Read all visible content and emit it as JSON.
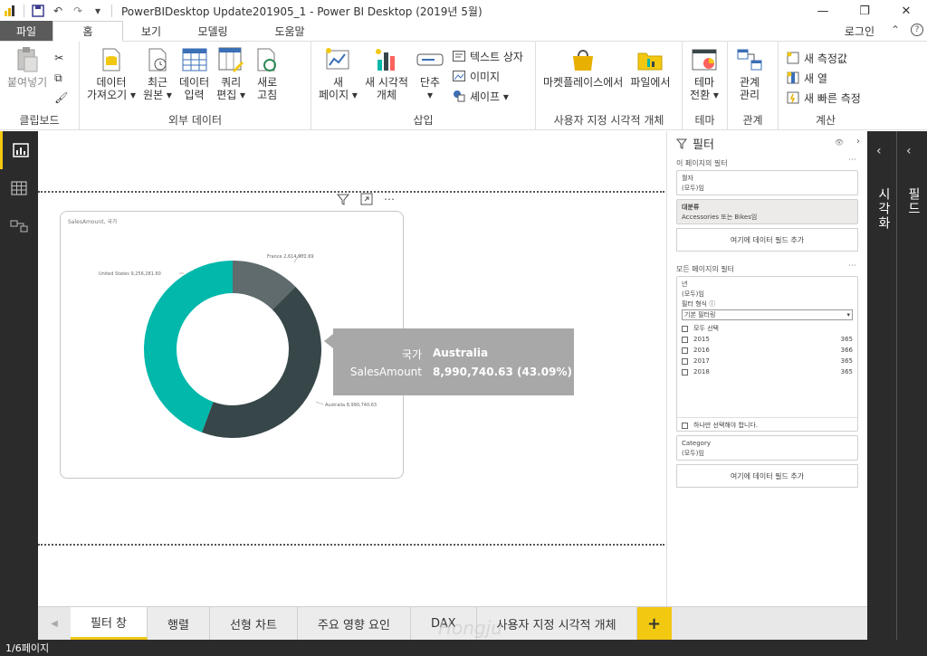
{
  "titlebar": {
    "title": "PowerBIDesktop Update201905_1 - Power BI Desktop (2019년 5월)"
  },
  "ribbon_tabs": {
    "file": "파일",
    "home": "홈",
    "view": "보기",
    "modeling": "모델링",
    "help": "도움말",
    "login": "로그인"
  },
  "ribbon": {
    "clipboard": {
      "paste": "붙여넣기",
      "label": "클립보드"
    },
    "external": {
      "get_data_1": "데이터",
      "get_data_2": "가져오기 ▾",
      "recent_1": "최근",
      "recent_2": "원본 ▾",
      "enter_1": "데이터",
      "enter_2": "입력",
      "query_1": "쿼리",
      "query_2": "편집 ▾",
      "refresh_1": "새로",
      "refresh_2": "고침",
      "label": "외부 데이터"
    },
    "insert": {
      "newpage_1": "새",
      "newpage_2": "페이지 ▾",
      "newvisual_1": "새 시각적",
      "newvisual_2": "개체",
      "ask_1": "단추",
      "ask_2": "▾",
      "textbox": "텍스트 상자",
      "image": "이미지",
      "shapes": "셰이프 ▾",
      "label": "삽입"
    },
    "custom": {
      "marketplace": "마켓플레이스에서",
      "fromfile": "파일에서",
      "label": "사용자 지정 시각적 개체"
    },
    "theme": {
      "switch_1": "테마",
      "switch_2": "전환 ▾",
      "label": "테마"
    },
    "relations": {
      "manage_1": "관계",
      "manage_2": "관리",
      "label": "관계"
    },
    "calc": {
      "new_measure": "새 측정값",
      "new_column": "새 열",
      "new_quick": "새 빠른 측정",
      "label": "계산"
    }
  },
  "visual": {
    "title": "SalesAmount, 국가",
    "label_france": "France 2,614,902.69",
    "label_us": "United States 9,256,281.60",
    "label_australia": "Australia 8,990,740.63"
  },
  "chart_data": {
    "type": "pie",
    "categories": [
      "France",
      "Australia",
      "United States"
    ],
    "values": [
      2614902.69,
      8990740.63,
      9256281.6
    ],
    "colors": [
      "#5f6b6d",
      "#374649",
      "#01b8aa"
    ],
    "title": "SalesAmount, 국가"
  },
  "tooltip": {
    "label1": "국가",
    "value1": "Australia",
    "label2": "SalesAmount",
    "value2": "8,990,740.63 (43.09%)"
  },
  "filters": {
    "title": "필터",
    "this_page": "이 페이지의 필터",
    "month_label": "월자",
    "month_value": "(모두)임",
    "cat_label": "대분류",
    "cat_value": "Accessories 또는 Bikes임",
    "add_field": "여기에 데이터 필드 추가",
    "all_pages": "모든 페이지의 필터",
    "year_label": "년",
    "year_value": "(모두)임",
    "filter_type_label": "필터 형식 ⓘ",
    "filter_type_value": "기본 필터링",
    "select_all": "모두 선택",
    "years": [
      {
        "label": "2015",
        "count": "365"
      },
      {
        "label": "2016",
        "count": "366"
      },
      {
        "label": "2017",
        "count": "365"
      },
      {
        "label": "2018",
        "count": "365"
      }
    ],
    "require_single": "하나만 선택해야 합니다.",
    "category_label": "Category",
    "category_value": "(모두)임",
    "add_field2": "여기에 데이터 필드 추가"
  },
  "panes": {
    "visualizations": "시각화",
    "fields": "필드"
  },
  "pagetabs": [
    "필터 창",
    "행렬",
    "선형 차트",
    "주요 영향 요인",
    "DAX",
    "사용자 지정 시각적 개체"
  ],
  "status": "1/6페이지",
  "watermark": "Hongju"
}
